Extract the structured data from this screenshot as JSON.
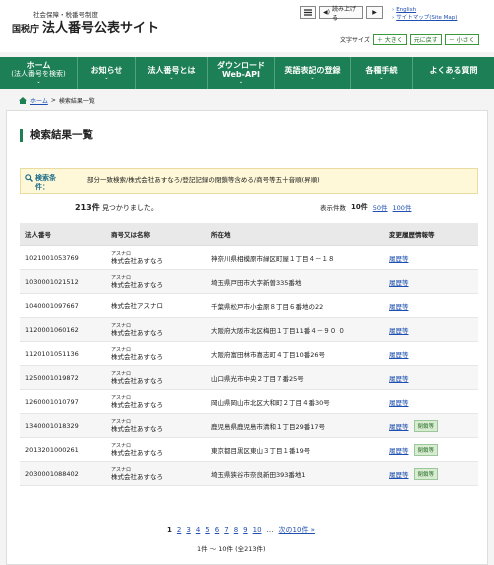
{
  "header": {
    "subtitle": "社会保障・税番号制度",
    "agency": "国税庁",
    "title": "法人番号公表サイト",
    "read_aloud": "読み上げる",
    "lang_english": "English",
    "lang_sitemap": "サイトマップ(Site Map)",
    "textsize_label": "文字サイズ",
    "size_large": "＋ 大きく",
    "size_reset": "元に戻す",
    "size_small": "－ 小さく"
  },
  "nav": {
    "items": [
      {
        "line1": "ホーム",
        "line2": "(法人番号を検索)"
      },
      {
        "line1": "お知らせ",
        "line2": ""
      },
      {
        "line1": "法人番号とは",
        "line2": ""
      },
      {
        "line1": "ダウンロード",
        "line2": "Web-API"
      },
      {
        "line1": "英語表記の登録",
        "line2": ""
      },
      {
        "line1": "各種手続",
        "line2": ""
      },
      {
        "line1": "よくある質問",
        "line2": ""
      }
    ]
  },
  "breadcrumb": {
    "home": "ホーム",
    "current": "検索結果一覧"
  },
  "main": {
    "title": "検索結果一覧",
    "search_label": "検索条件：",
    "search_conditions": "部分一致検索/株式会社あすなろ/登記記録の閉鎖等含める/商号等五十音順(昇順)",
    "count_number": "213件",
    "count_suffix": "見つかりました。",
    "perpage_label": "表示件数",
    "perpage_current": "10件",
    "perpage_50": "50件",
    "perpage_100": "100件",
    "columns": [
      "法人番号",
      "商号又は名称",
      "所在地",
      "変更履歴情報等"
    ],
    "rows": [
      {
        "num": "1021001053769",
        "kana": "アスナロ",
        "name": "株式会社あすなろ",
        "addr": "神奈川県相模原市緑区町屋１丁目４－１８",
        "hist": "履歴等",
        "closed": ""
      },
      {
        "num": "1030001021512",
        "kana": "アスナロ",
        "name": "株式会社あすなろ",
        "addr": "埼玉県戸田市大字新曽335番地",
        "hist": "履歴等",
        "closed": ""
      },
      {
        "num": "1040001097667",
        "kana": "",
        "name": "株式会社アスナロ",
        "addr": "千葉県松戸市小金原８丁目６番地の22",
        "hist": "履歴等",
        "closed": ""
      },
      {
        "num": "1120001060162",
        "kana": "アスナロ",
        "name": "株式会社あすなろ",
        "addr": "大阪府大阪市北区梅田１丁目11番４－９０ ０",
        "hist": "履歴等",
        "closed": ""
      },
      {
        "num": "1120101051136",
        "kana": "アスナロ",
        "name": "株式会社あすなろ",
        "addr": "大阪府富田林市喜志町４丁目10番26号",
        "hist": "履歴等",
        "closed": ""
      },
      {
        "num": "1250001019872",
        "kana": "アスナロ",
        "name": "株式会社あすなろ",
        "addr": "山口県光市中央２丁目７番25号",
        "hist": "履歴等",
        "closed": ""
      },
      {
        "num": "1260001010797",
        "kana": "アスナロ",
        "name": "株式会社あすなろ",
        "addr": "岡山県岡山市北区大和町２丁目４番30号",
        "hist": "履歴等",
        "closed": ""
      },
      {
        "num": "1340001018329",
        "kana": "アスナロ",
        "name": "株式会社あすなろ",
        "addr": "鹿児島県鹿児島市清和１丁目29番17号",
        "hist": "履歴等",
        "closed": "閉鎖等"
      },
      {
        "num": "2013201000261",
        "kana": "アスナロ",
        "name": "株式会社あすなろ",
        "addr": "東京都目黒区東山３丁目１番19号",
        "hist": "履歴等",
        "closed": "閉鎖等"
      },
      {
        "num": "2030001088402",
        "kana": "アスナロ",
        "name": "株式会社あすなろ",
        "addr": "埼玉県狭谷市奈良新田393番地1",
        "hist": "履歴等",
        "closed": "閉鎖等"
      }
    ],
    "pager": {
      "current": "1",
      "pages": [
        "2",
        "3",
        "4",
        "5",
        "6",
        "7",
        "8",
        "9",
        "10"
      ],
      "ellipsis": "…",
      "next": "次の10件 »"
    },
    "range": "1件 ～ 10件 (全213件)"
  },
  "colors": {
    "nav_green": "#1d7f55",
    "link_blue": "#1f4fb0",
    "search_bg": "#fff8d8",
    "closed_badge_bg": "#d7ecd0"
  }
}
